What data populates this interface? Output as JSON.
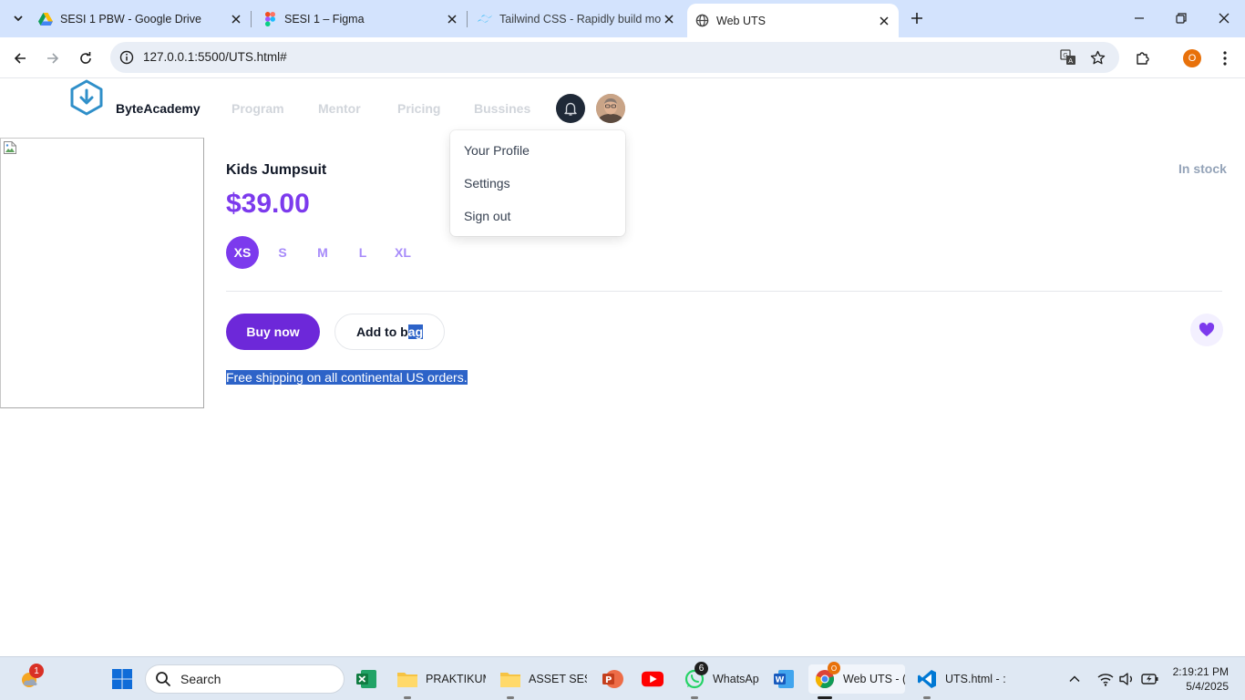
{
  "browser": {
    "tabs": [
      {
        "title": "SESI 1 PBW - Google Drive",
        "icon": "google-drive-icon",
        "active": false
      },
      {
        "title": "SESI 1 – Figma",
        "icon": "figma-icon",
        "active": false
      },
      {
        "title": "Tailwind CSS - Rapidly build mo",
        "icon": "tailwind-icon",
        "active": false
      },
      {
        "title": "Web UTS",
        "icon": "globe-icon",
        "active": true
      }
    ],
    "url": "127.0.0.1:5500/UTS.html#",
    "profile_initial": "O"
  },
  "site": {
    "brand": "ByteAcademy",
    "nav": [
      "Program",
      "Mentor",
      "Pricing",
      "Bussines"
    ],
    "dropdown": [
      "Your Profile",
      "Settings",
      "Sign out"
    ]
  },
  "product": {
    "title": "Kids Jumpsuit",
    "price": "$39.00",
    "stock": "In stock",
    "sizes": [
      "XS",
      "S",
      "M",
      "L",
      "XL"
    ],
    "selected_size": "XS",
    "buy_label": "Buy now",
    "bag_label_plain": "Add to b",
    "bag_label_selected": "ag",
    "shipping": "Free shipping on all continental US orders."
  },
  "taskbar": {
    "search_placeholder": "Search",
    "weather_badge": "1",
    "apps": [
      {
        "name": "excel",
        "label": ""
      },
      {
        "name": "folder-praktikum",
        "label": "PRAKTIKUM"
      },
      {
        "name": "folder-asset",
        "label": "ASSET SESI"
      },
      {
        "name": "powerpoint",
        "label": ""
      },
      {
        "name": "youtube",
        "label": ""
      },
      {
        "name": "whatsapp",
        "label": "WhatsAp",
        "badge": "6"
      },
      {
        "name": "word",
        "label": ""
      },
      {
        "name": "chrome",
        "label": "Web UTS - (",
        "badge": "O"
      },
      {
        "name": "vscode",
        "label": "UTS.html - :"
      }
    ],
    "time": "2:19:21 PM",
    "date": "5/4/2025"
  },
  "colors": {
    "accent": "#7c3aed",
    "accent_dark": "#6d28d9",
    "selection": "#2d63c8"
  }
}
